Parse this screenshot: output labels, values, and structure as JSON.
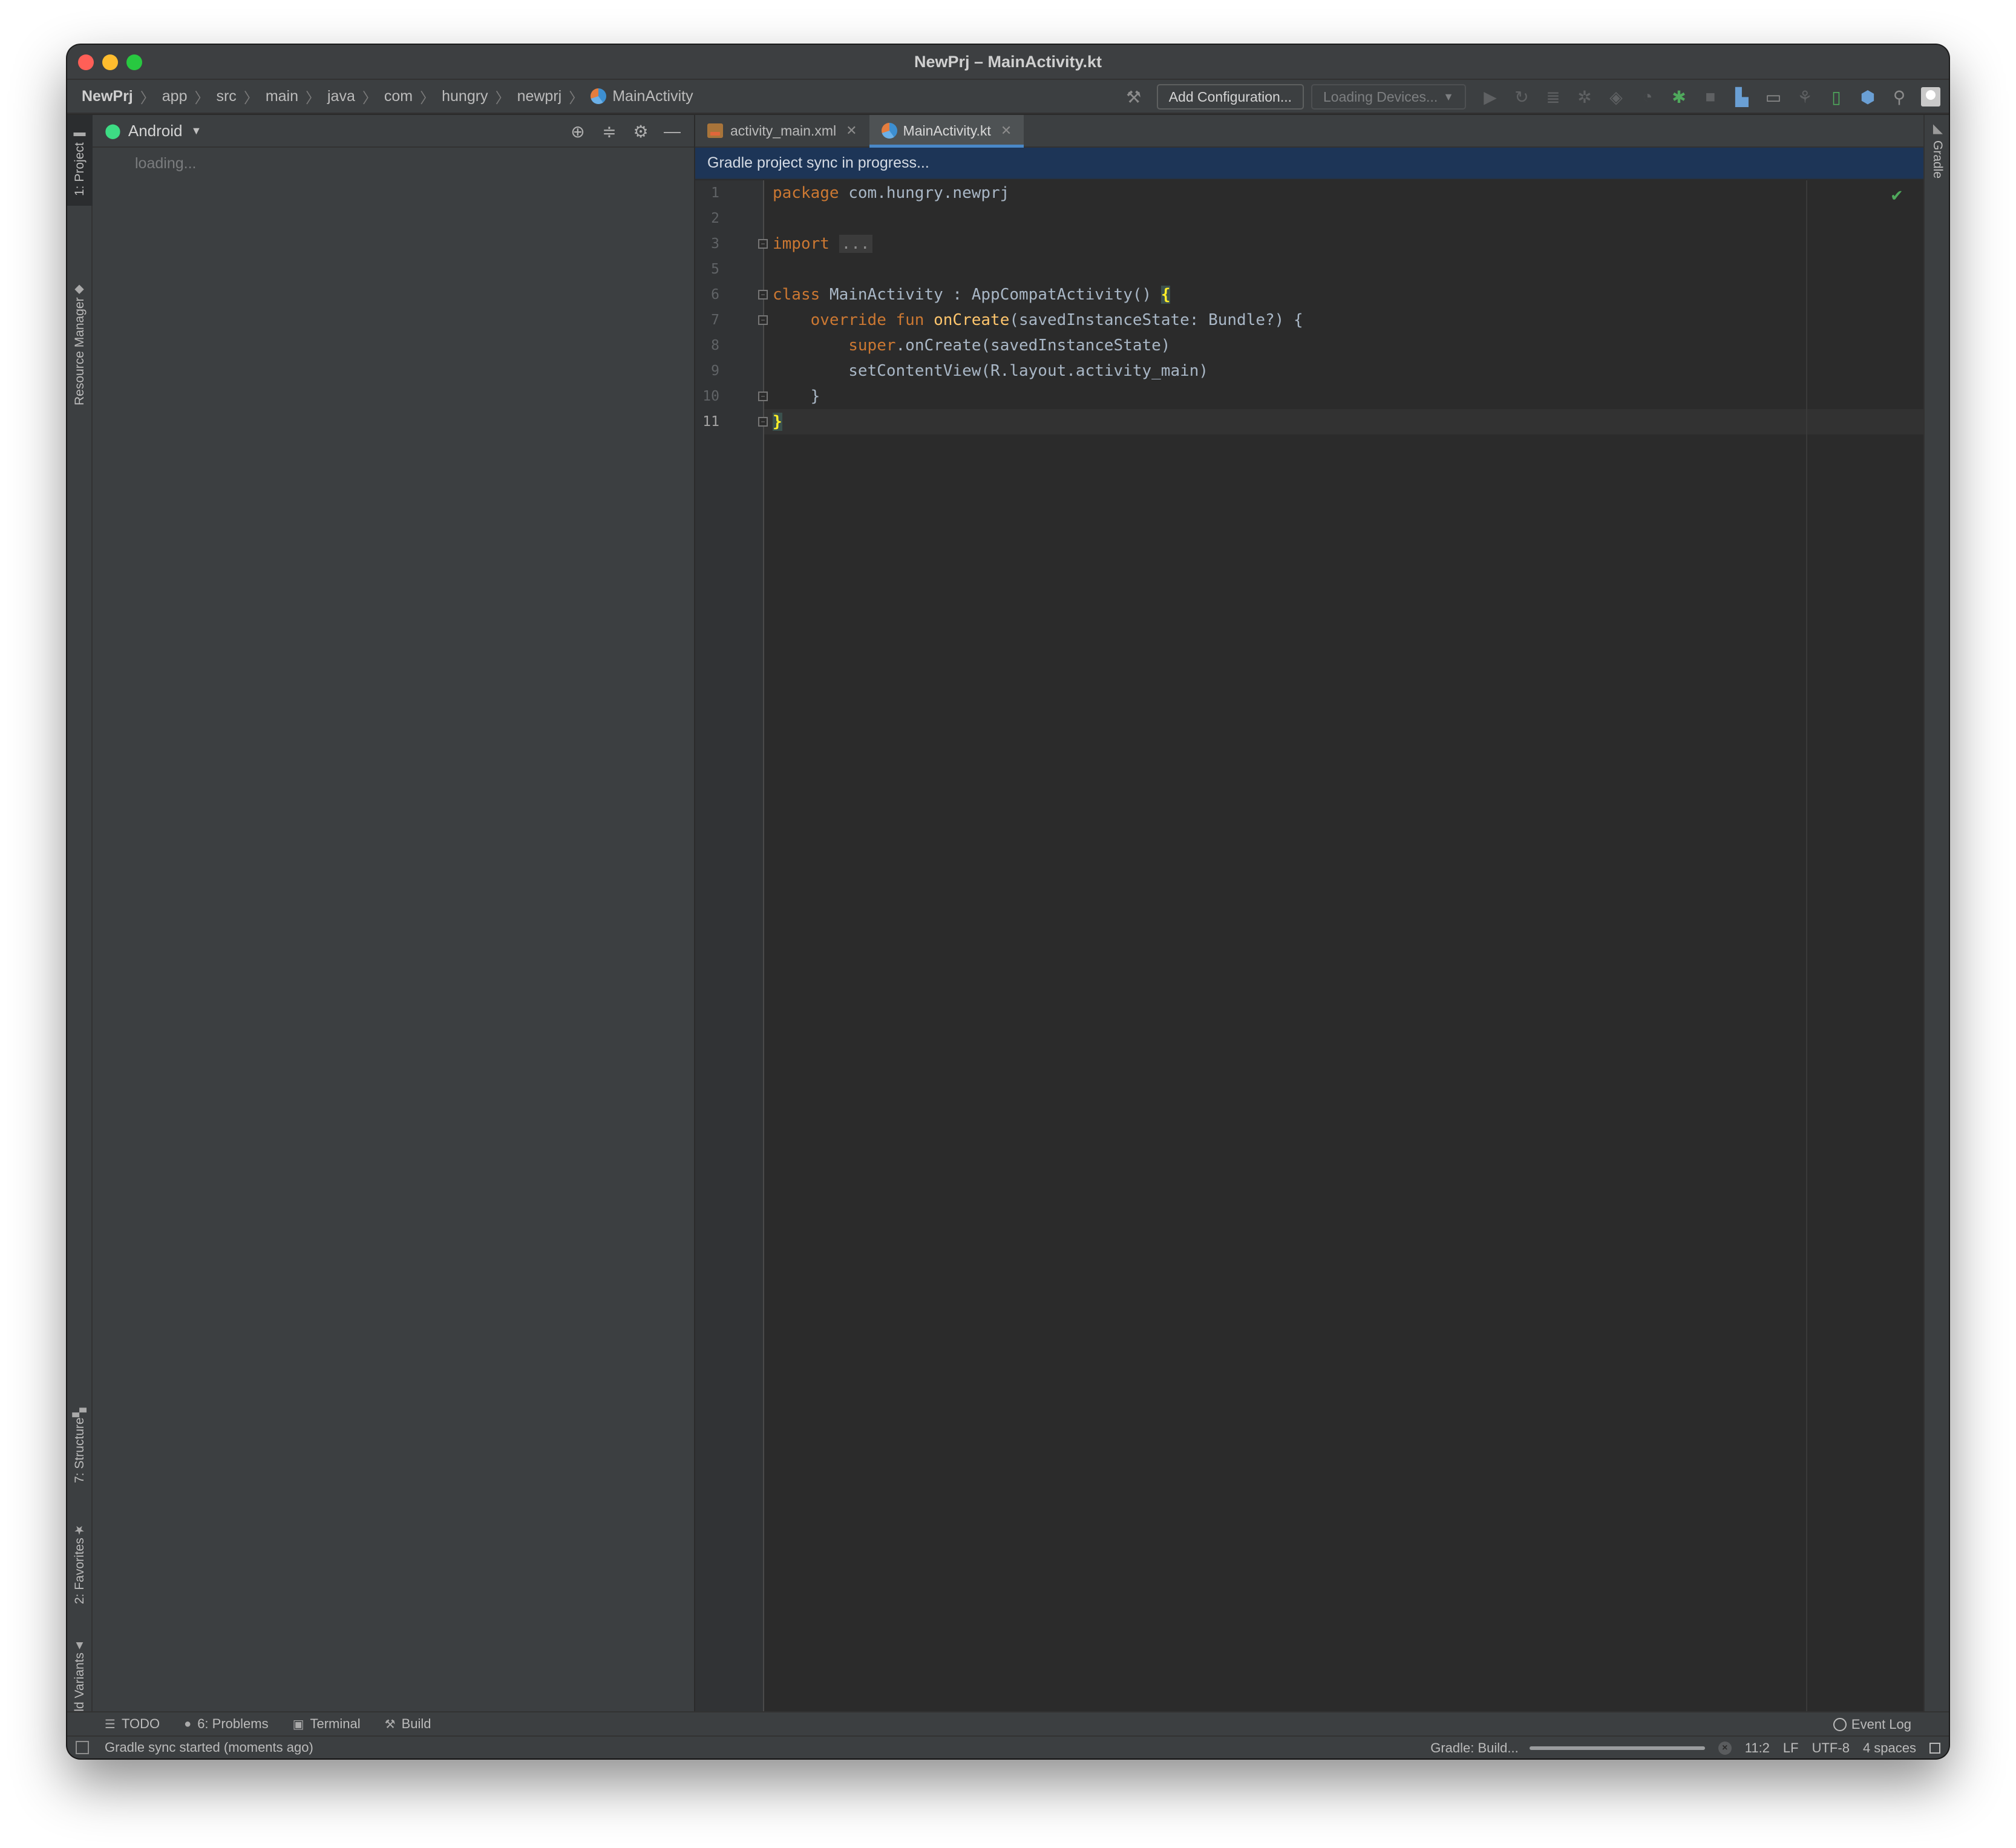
{
  "window": {
    "title": "NewPrj – MainActivity.kt"
  },
  "breadcrumbs": [
    "NewPrj",
    "app",
    "src",
    "main",
    "java",
    "com",
    "hungry",
    "newprj",
    "MainActivity"
  ],
  "toolbar": {
    "add_configuration": "Add Configuration...",
    "devices": "Loading Devices..."
  },
  "left_strip": {
    "project": "1: Project",
    "resource_manager": "Resource Manager",
    "structure": "7: Structure",
    "favorites": "2: Favorites",
    "build_variants": "Build Variants"
  },
  "right_strip": {
    "gradle": "Gradle"
  },
  "project_panel": {
    "view": "Android",
    "status": "loading..."
  },
  "editor": {
    "tabs": [
      {
        "label": "activity_main.xml",
        "active": false
      },
      {
        "label": "MainActivity.kt",
        "active": true
      }
    ],
    "banner": "Gradle project sync in progress...",
    "line_numbers": [
      "1",
      "2",
      "3",
      "5",
      "6",
      "7",
      "8",
      "9",
      "10",
      "11"
    ],
    "code": {
      "l1_kw": "package",
      "l1_rest": " com.hungry.newprj",
      "l3_kw": "import",
      "l3_fold": "...",
      "l6_kw": "class",
      "l6_rest": " MainActivity : AppCompatActivity() ",
      "l6_brace": "{",
      "l7_indent": "    ",
      "l7_kw": "override fun",
      "l7_fn": "onCreate",
      "l7_rest": "(savedInstanceState: Bundle?) {",
      "l8_indent": "        ",
      "l8_kw": "super",
      "l8_rest": ".onCreate(savedInstanceState)",
      "l9_text": "        setContentView(R.layout.activity_main)",
      "l10_text": "    }",
      "l11_brace": "}"
    }
  },
  "bottom_tools": {
    "todo": "TODO",
    "problems": "6: Problems",
    "terminal": "Terminal",
    "build": "Build",
    "event_log": "Event Log"
  },
  "statusbar": {
    "message": "Gradle sync started (moments ago)",
    "gradle": "Gradle: Build...",
    "progress": 1.0,
    "position": "11:2",
    "line_sep": "LF",
    "encoding": "UTF-8",
    "indent": "4 spaces"
  }
}
